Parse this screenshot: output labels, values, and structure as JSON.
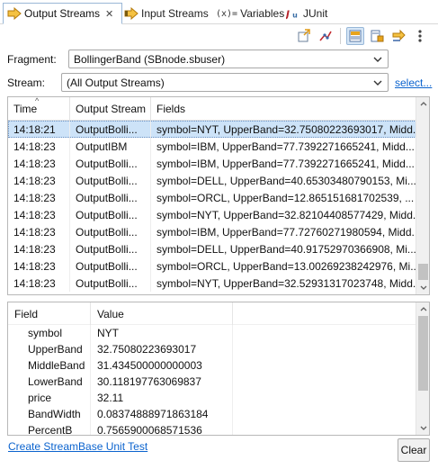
{
  "tabs": [
    {
      "label": "Output Streams",
      "close": "✕",
      "active": true,
      "icon": "output-streams-icon"
    },
    {
      "label": "Input Streams",
      "active": false,
      "icon": "input-streams-icon"
    },
    {
      "label": "Variables",
      "prefix": "(x)=",
      "active": false,
      "icon": "variables-icon"
    },
    {
      "label": "JUnit",
      "active": false,
      "icon": "junit-icon"
    }
  ],
  "toolbar": {
    "buttons": [
      "export-icon",
      "filter-icon",
      "layout-vertical-icon",
      "lock-icon",
      "pin-icon",
      "view-menu-icon"
    ]
  },
  "fragment": {
    "label": "Fragment:",
    "value": "BollingerBand (SBnode.sbuser)"
  },
  "stream": {
    "label": "Stream:",
    "value": "(All Output Streams)",
    "select_link": "select..."
  },
  "table": {
    "headers": {
      "time": "Time",
      "stream": "Output Stream",
      "fields": "Fields"
    },
    "rows": [
      {
        "time": "14:18:21",
        "stream": "OutputBolli...",
        "fields": "symbol=NYT, UpperBand=32.75080223693017, Midd..."
      },
      {
        "time": "14:18:23",
        "stream": "OutputIBM",
        "fields": "symbol=IBM, UpperBand=77.7392271665241, Midd..."
      },
      {
        "time": "14:18:23",
        "stream": "OutputBolli...",
        "fields": "symbol=IBM, UpperBand=77.7392271665241, Midd..."
      },
      {
        "time": "14:18:23",
        "stream": "OutputBolli...",
        "fields": "symbol=DELL, UpperBand=40.65303480790153, Mi..."
      },
      {
        "time": "14:18:23",
        "stream": "OutputBolli...",
        "fields": "symbol=ORCL, UpperBand=12.865151681702539, ..."
      },
      {
        "time": "14:18:23",
        "stream": "OutputBolli...",
        "fields": "symbol=NYT, UpperBand=32.82104408577429, Midd..."
      },
      {
        "time": "14:18:23",
        "stream": "OutputBolli...",
        "fields": "symbol=IBM, UpperBand=77.72760271980594, Midd..."
      },
      {
        "time": "14:18:23",
        "stream": "OutputBolli...",
        "fields": "symbol=DELL, UpperBand=40.91752970366908, Mi..."
      },
      {
        "time": "14:18:23",
        "stream": "OutputBolli...",
        "fields": "symbol=ORCL, UpperBand=13.00269238242976, Mi..."
      },
      {
        "time": "14:18:23",
        "stream": "OutputBolli...",
        "fields": "symbol=NYT, UpperBand=32.52931317023748, Midd..."
      }
    ],
    "selected_row": 0
  },
  "details": {
    "headers": {
      "field": "Field",
      "value": "Value"
    },
    "rows": [
      {
        "field": "symbol",
        "value": "NYT"
      },
      {
        "field": "UpperBand",
        "value": "32.75080223693017"
      },
      {
        "field": "MiddleBand",
        "value": "31.434500000000003"
      },
      {
        "field": "LowerBand",
        "value": "30.118197763069837"
      },
      {
        "field": "price",
        "value": "32.11"
      },
      {
        "field": "BandWidth",
        "value": "0.08374888971863184"
      },
      {
        "field": "PercentB",
        "value": "0.7565900068571536"
      }
    ]
  },
  "create_test_link": "Create StreamBase Unit Test",
  "clear_button": "Clear",
  "colors": {
    "accent": "#0b63ce",
    "selection": "#cde3f8",
    "output_icon": "#e8a41b"
  }
}
